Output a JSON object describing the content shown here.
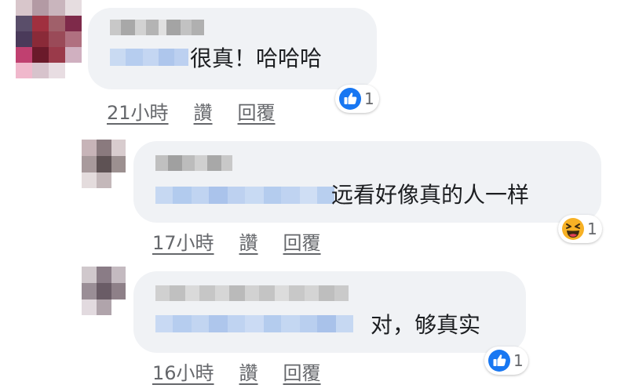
{
  "comments": [
    {
      "text": "很真！哈哈哈",
      "time": "21小時",
      "like_label": "讚",
      "reply_label": "回覆",
      "reaction": {
        "icon": "like-icon",
        "count": "1"
      }
    },
    {
      "text": "远看好像真的人一样",
      "time": "17小時",
      "like_label": "讚",
      "reply_label": "回覆",
      "reaction": {
        "icon": "haha-icon",
        "count": "1"
      }
    },
    {
      "text": "对，够真实",
      "time": "16小時",
      "like_label": "讚",
      "reply_label": "回覆",
      "reaction": {
        "icon": "like-icon",
        "count": "1"
      }
    }
  ],
  "colors": {
    "bubble": "#f0f2f5",
    "like_blue": "#1877f2",
    "haha_yellow": "#f7b125",
    "meta_gray": "#65676b"
  }
}
